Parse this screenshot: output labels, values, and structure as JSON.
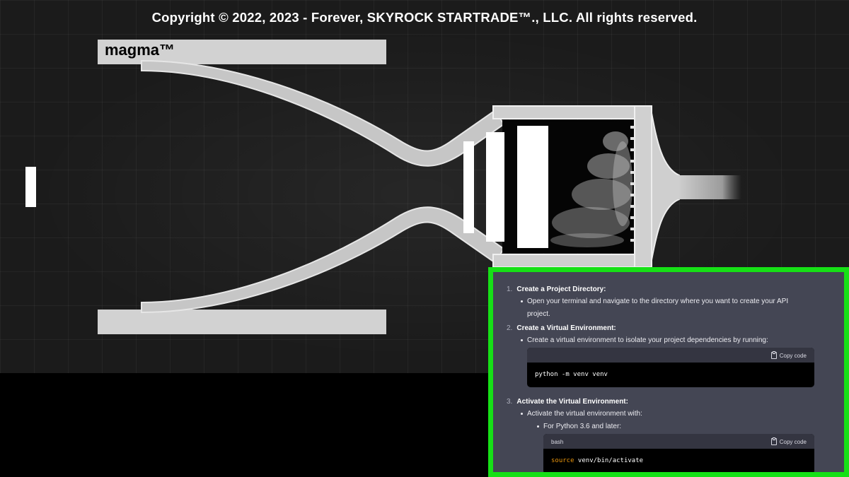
{
  "header": {
    "copyright": "Copyright © 2022, 2023 - Forever, SKYROCK STARTRADE™., LLC. All rights reserved."
  },
  "diagram": {
    "brand": "magma™"
  },
  "instructions": {
    "steps": [
      {
        "number": "1.",
        "title": "Create a Project Directory:",
        "bullets": [
          "Open your terminal and navigate to the directory where you want to create your API",
          "project."
        ]
      },
      {
        "number": "2.",
        "title": "Create a Virtual Environment:",
        "bullets": [
          "Create a virtual environment to isolate your project dependencies by running:"
        ],
        "code": {
          "copy_label": "Copy code",
          "text": "python -m venv venv"
        }
      },
      {
        "number": "3.",
        "title": "Activate the Virtual Environment:",
        "bullets": [
          "Activate the virtual environment with:"
        ],
        "sub_bullets": [
          "For Python 3.6 and later:"
        ],
        "code": {
          "language": "bash",
          "copy_label": "Copy code",
          "keyword": "source",
          "text": " venv/bin/activate"
        }
      }
    ]
  },
  "colors": {
    "panel_border": "#16e016",
    "panel_bg": "#444654",
    "code_keyword": "#e9950c"
  }
}
